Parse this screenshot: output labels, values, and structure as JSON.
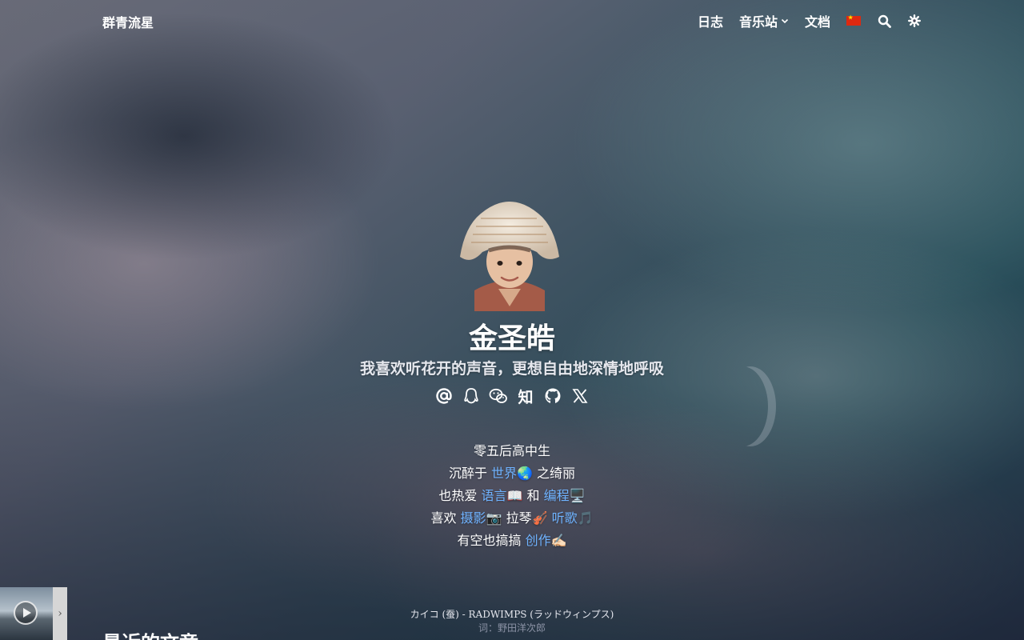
{
  "header": {
    "brand": "群青流星",
    "nav": {
      "log": "日志",
      "music": "音乐站",
      "docs": "文档"
    },
    "icons": [
      "china-flag-icon",
      "search-icon",
      "theme-gear-icon"
    ]
  },
  "profile": {
    "name": "金圣皓",
    "subtitle": "我喜欢听花开的声音，更想自由地深情地呼吸",
    "social_icons": [
      "email-icon",
      "qq-icon",
      "wechat-icon",
      "zhihu-icon",
      "github-icon",
      "x-icon"
    ],
    "zhihu_label": "知"
  },
  "bio": {
    "line1": "零五后高中生",
    "line2_pre": "沉醉于 ",
    "line2_link": "世界🌏",
    "line2_post": " 之绮丽",
    "line3_pre": "也热爱 ",
    "line3_link1": "语言📖",
    "line3_mid": " 和 ",
    "line3_link2": "编程🖥️",
    "line4_pre": "喜欢 ",
    "line4_link1": "摄影📷",
    "line4_mid": " 拉琴🎻 ",
    "line4_link2": "听歌🎵",
    "line5_pre": "有空也搞搞 ",
    "line5_link": "创作✍🏻"
  },
  "player": {
    "lyric_title": "カイコ (蚕) - RADWIMPS (ラッドウィンプス)",
    "lyric_credit": "词：野田洋次郎",
    "toggle": "›"
  },
  "section": {
    "recent_posts": "最近的文章"
  },
  "colors": {
    "link": "#6fb3ff",
    "text": "#ffffff"
  }
}
